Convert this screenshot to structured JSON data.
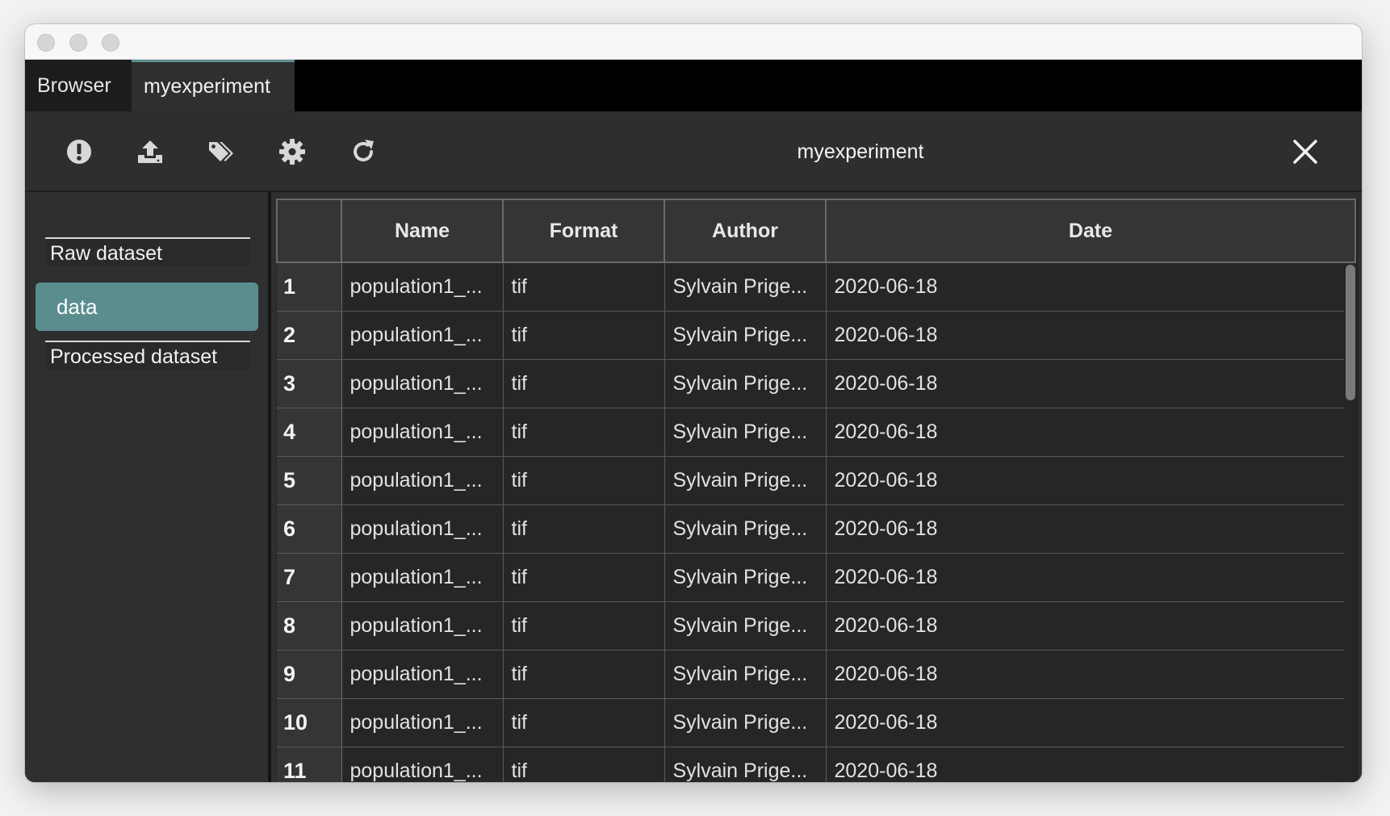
{
  "tabs": [
    {
      "label": "Browser"
    },
    {
      "label": "myexperiment"
    }
  ],
  "toolbar": {
    "title": "myexperiment",
    "icons": [
      "alert-icon",
      "upload-icon",
      "tags-icon",
      "gear-icon",
      "refresh-icon",
      "close-icon"
    ]
  },
  "sidebar": {
    "sections": [
      {
        "header": "Raw dataset",
        "items": [
          "data"
        ]
      },
      {
        "header": "Processed dataset",
        "items": []
      }
    ]
  },
  "table": {
    "columns": [
      "",
      "Name",
      "Format",
      "Author",
      "Date"
    ],
    "rows": [
      {
        "num": "1",
        "name": "population1_...",
        "format": "tif",
        "author": "Sylvain Prige...",
        "date": "2020-06-18"
      },
      {
        "num": "2",
        "name": "population1_...",
        "format": "tif",
        "author": "Sylvain Prige...",
        "date": "2020-06-18"
      },
      {
        "num": "3",
        "name": "population1_...",
        "format": "tif",
        "author": "Sylvain Prige...",
        "date": "2020-06-18"
      },
      {
        "num": "4",
        "name": "population1_...",
        "format": "tif",
        "author": "Sylvain Prige...",
        "date": "2020-06-18"
      },
      {
        "num": "5",
        "name": "population1_...",
        "format": "tif",
        "author": "Sylvain Prige...",
        "date": "2020-06-18"
      },
      {
        "num": "6",
        "name": "population1_...",
        "format": "tif",
        "author": "Sylvain Prige...",
        "date": "2020-06-18"
      },
      {
        "num": "7",
        "name": "population1_...",
        "format": "tif",
        "author": "Sylvain Prige...",
        "date": "2020-06-18"
      },
      {
        "num": "8",
        "name": "population1_...",
        "format": "tif",
        "author": "Sylvain Prige...",
        "date": "2020-06-18"
      },
      {
        "num": "9",
        "name": "population1_...",
        "format": "tif",
        "author": "Sylvain Prige...",
        "date": "2020-06-18"
      },
      {
        "num": "10",
        "name": "population1_...",
        "format": "tif",
        "author": "Sylvain Prige...",
        "date": "2020-06-18"
      },
      {
        "num": "11",
        "name": "population1_...",
        "format": "tif",
        "author": "Sylvain Prige...",
        "date": "2020-06-18"
      }
    ]
  },
  "colors": {
    "accent": "#5b8d8f",
    "background": "#2f2f2f",
    "tabbar": "#000000",
    "table_bg": "#262626"
  }
}
